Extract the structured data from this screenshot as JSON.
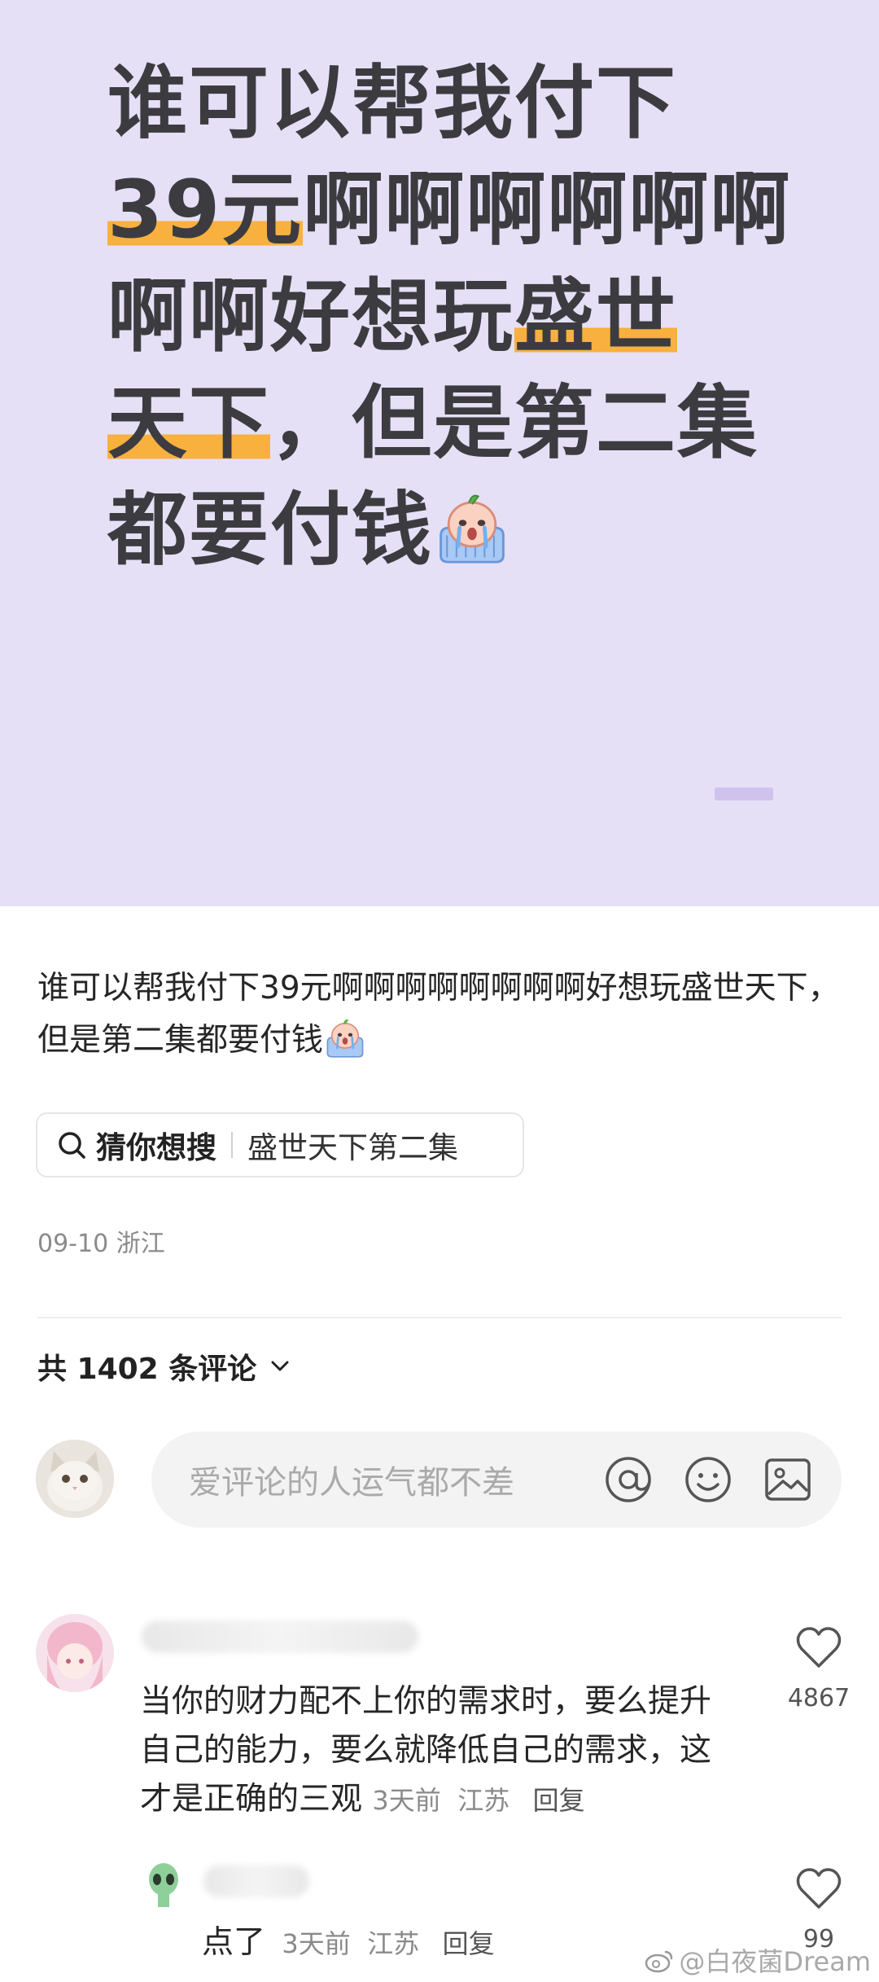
{
  "hero": {
    "line1": "谁可以帮我付下",
    "line2_hl": "39元",
    "line2_rest": "啊啊啊啊啊啊",
    "line3_rest": "啊啊好想玩",
    "line3_hl": "盛世",
    "line4_hl": "天下",
    "line4_rest": "，但是第二集",
    "line5": "都要付钱"
  },
  "post": {
    "body": "谁可以帮我付下39元啊啊啊啊啊啊啊啊好想玩盛世天下，但是第二集都要付钱"
  },
  "search_chip": {
    "label": "猜你想搜",
    "query": "盛世天下第二集"
  },
  "meta": {
    "date_location": "09-10 浙江"
  },
  "comments_header": {
    "count_label": "共 1402 条评论"
  },
  "comment_input": {
    "placeholder": "爱评论的人运气都不差"
  },
  "comments": [
    {
      "text": "当你的财力配不上你的需求时，要么提升自己的能力，要么就降低自己的需求，这才是正确的三观",
      "time": "3天前",
      "location": "江苏",
      "reply_label": "回复",
      "likes": "4867"
    },
    {
      "text": "点了",
      "time": "3天前",
      "location": "江苏",
      "reply_label": "回复",
      "likes": "99"
    }
  ],
  "watermark": "@白夜菌Dream",
  "colors": {
    "hero_bg": "#e6e0f7",
    "highlight": "#f8b13f",
    "hero_text": "#3c3c40"
  }
}
